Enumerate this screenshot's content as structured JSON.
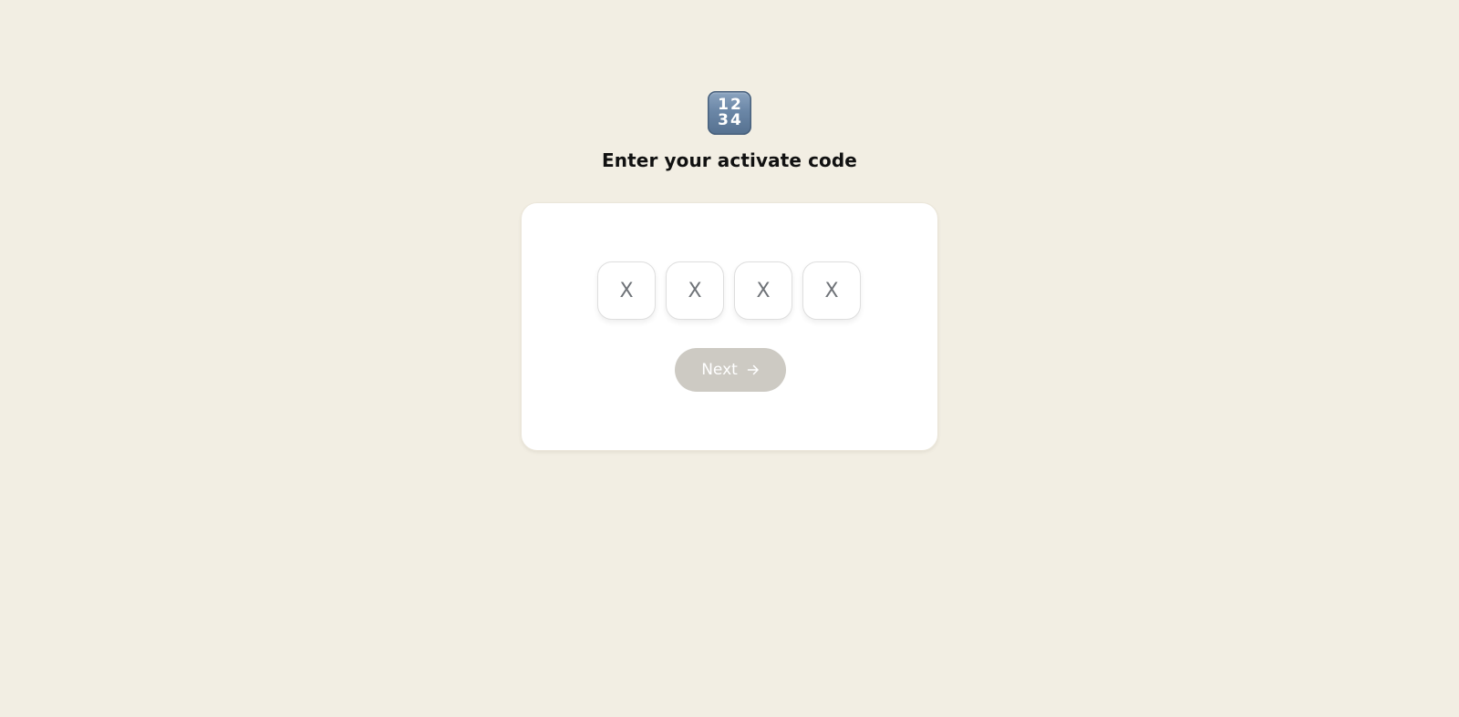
{
  "logo": {
    "icon": "numbers-1234-icon",
    "row1": "12",
    "row2": "34"
  },
  "heading": {
    "title": "Enter your activate code"
  },
  "code": {
    "placeholders": [
      "X",
      "X",
      "X",
      "X"
    ]
  },
  "actions": {
    "next_label": "Next",
    "next_icon": "arrow-right-icon"
  },
  "colors": {
    "background": "#f2eee3",
    "card": "#ffffff",
    "button_disabled": "#cdcac3"
  }
}
